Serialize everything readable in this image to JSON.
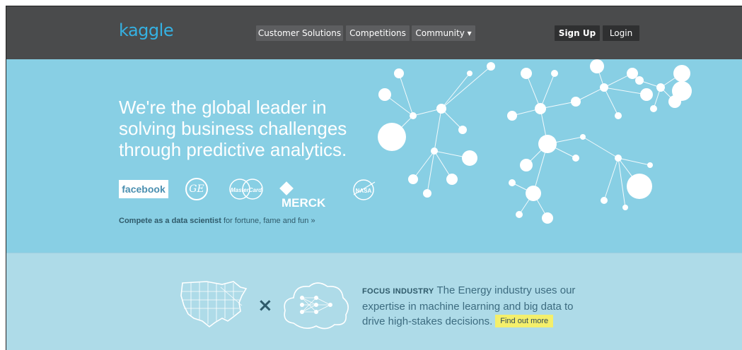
{
  "header": {
    "logo": "kaggle",
    "nav": [
      {
        "label": "Customer Solutions"
      },
      {
        "label": "Competitions"
      },
      {
        "label": "Community ▾"
      }
    ],
    "signup_label": "Sign Up",
    "login_label": "Login"
  },
  "hero": {
    "headline_lines": [
      "We're the global leader in",
      "solving business challenges",
      "through predictive analytics."
    ],
    "partner_logos": {
      "facebook": "facebook",
      "ge": "GE",
      "mastercard": "MasterCard",
      "merck": "MERCK",
      "nasa": "NASA"
    },
    "compete_bold": "Compete as a data scientist",
    "compete_rest": " for fortune, fame and fun »"
  },
  "focus": {
    "kicker": "FOCUS INDUSTRY",
    "text": " The Energy industry uses our expertise in machine learning and big data to drive high-stakes decisions.",
    "cta_label": "Find out more"
  },
  "colors": {
    "topbar": "#4a4b4c",
    "hero_bg": "#88cfe4",
    "lower_bg": "#aedbe8",
    "logo_accent": "#35b1e2",
    "cta_bg": "#f4ef6b"
  }
}
